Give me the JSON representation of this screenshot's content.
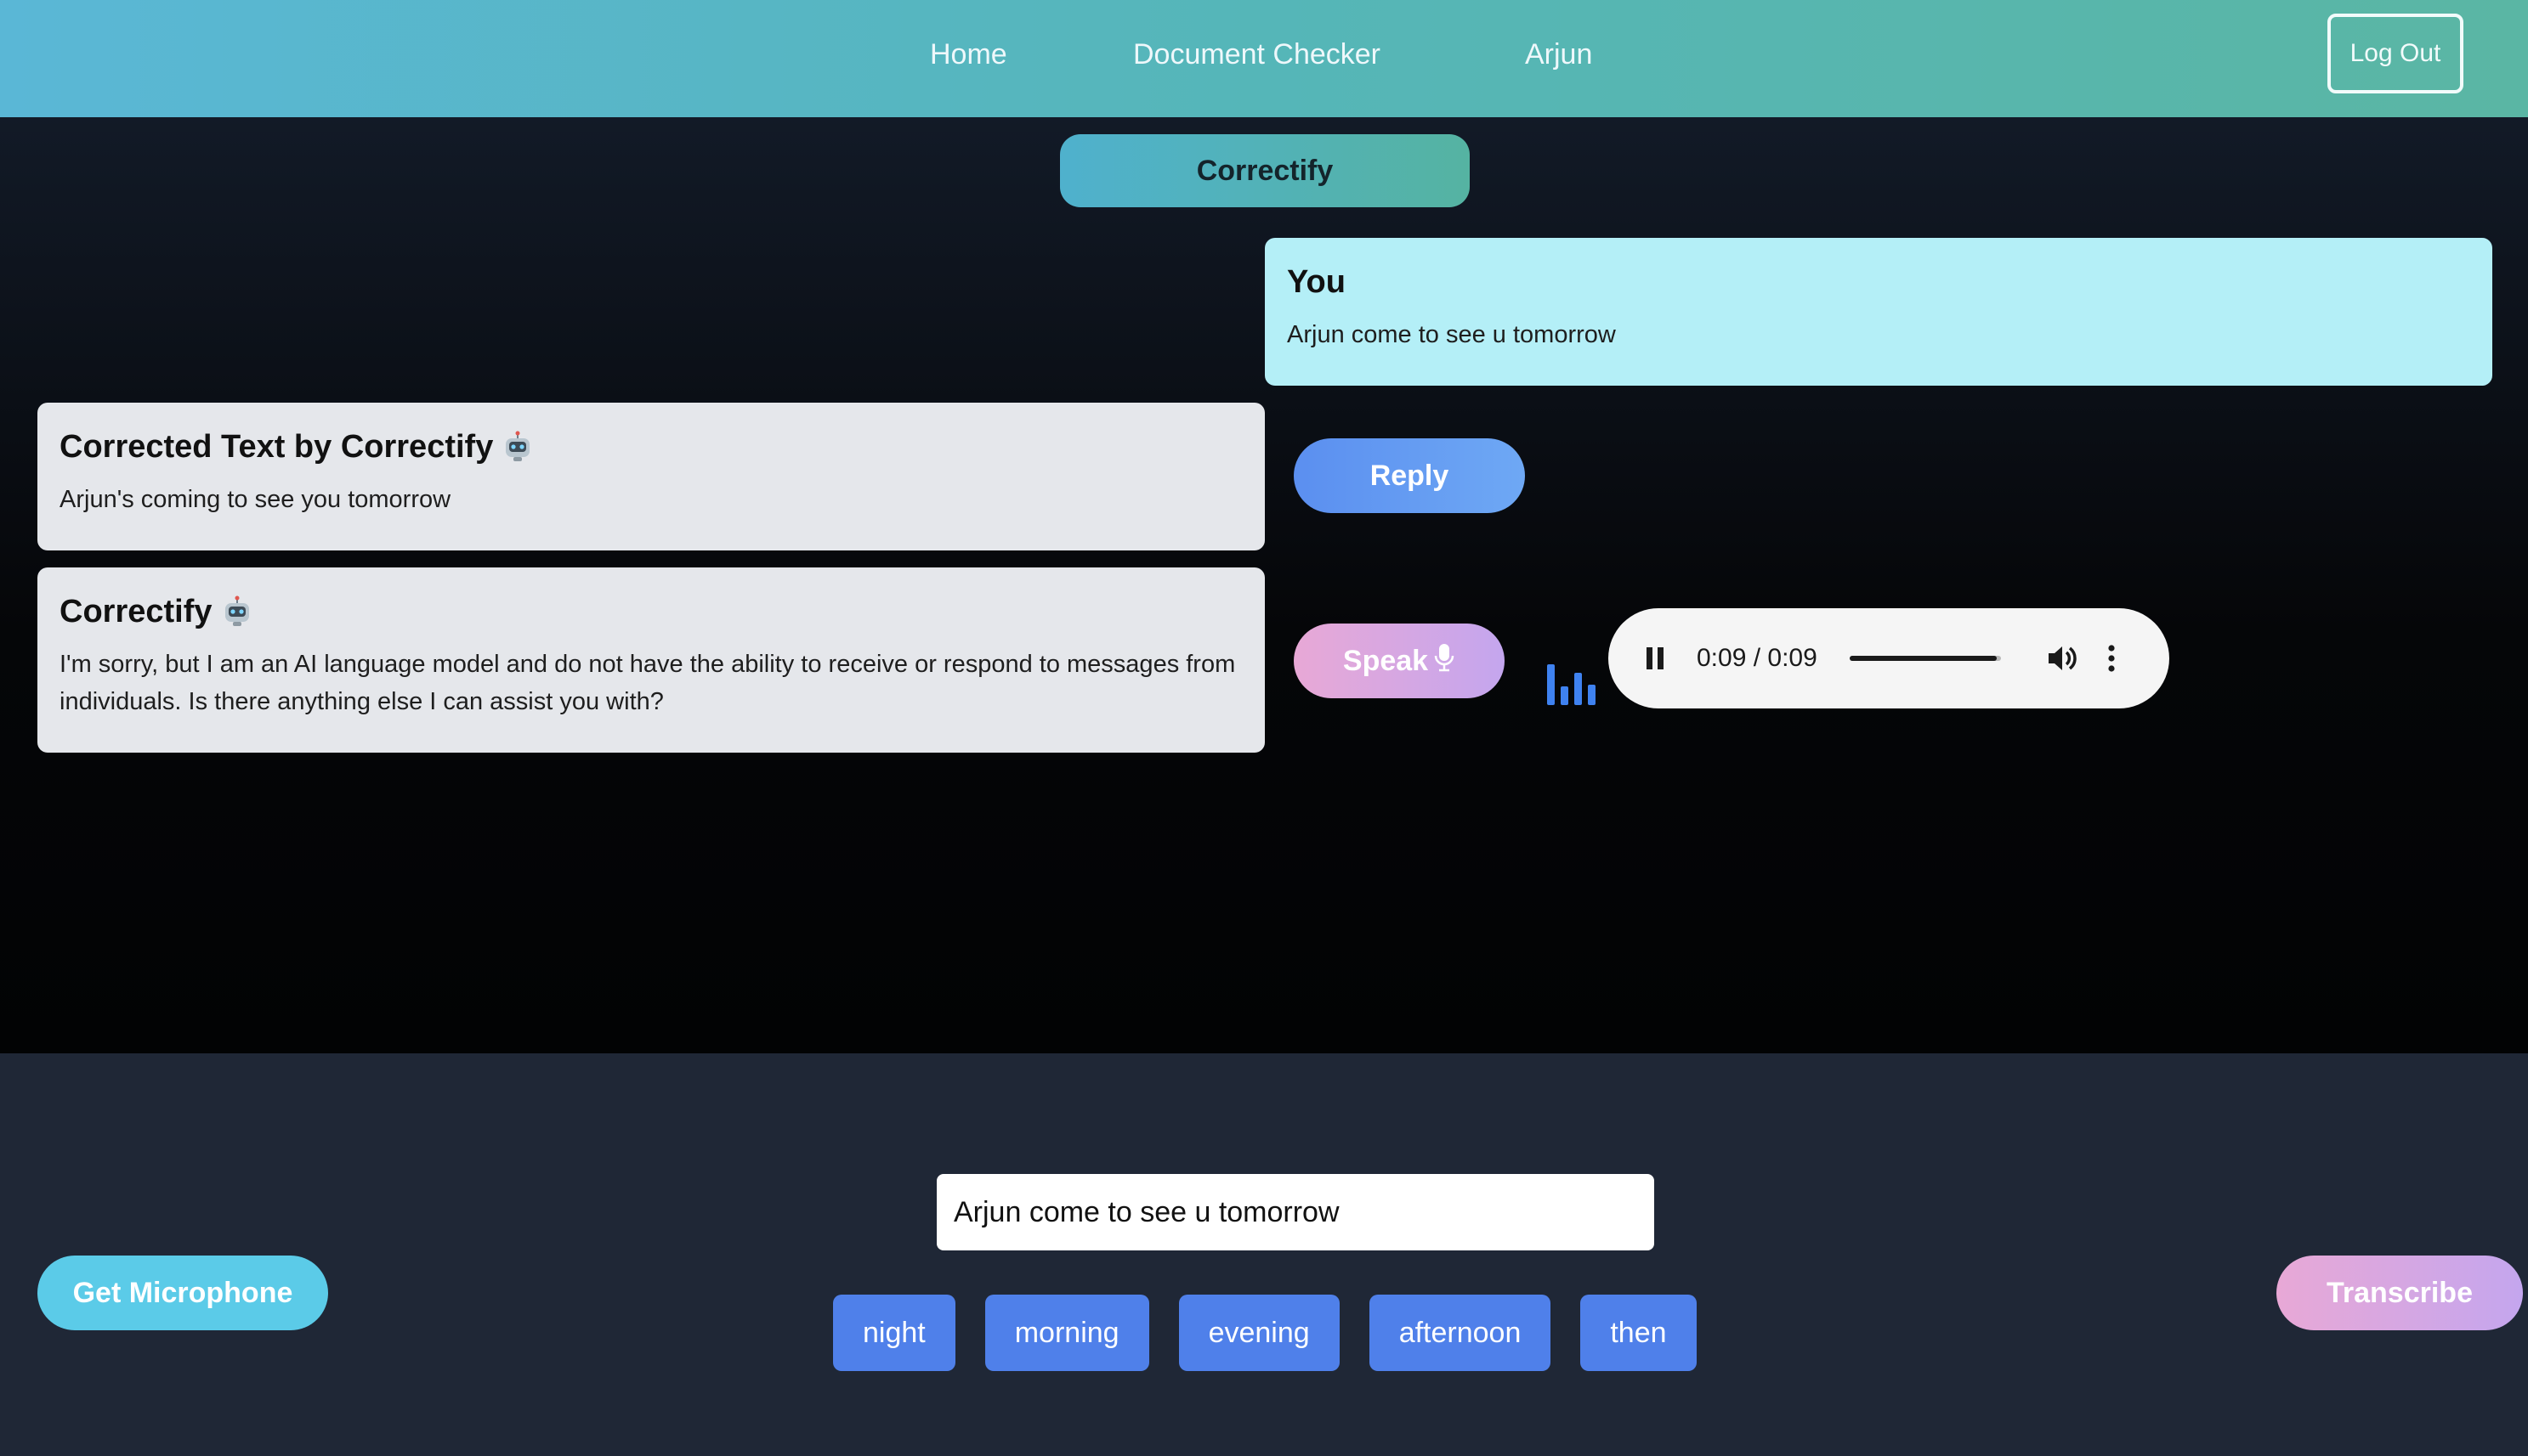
{
  "nav": {
    "links": [
      "Home",
      "Document Checker",
      "Arjun"
    ],
    "logout_label": "Log Out"
  },
  "brand": {
    "title": "Correctify"
  },
  "messages": {
    "user": {
      "title": "You",
      "body": "Arjun come to see u tomorrow"
    },
    "corrected": {
      "title": "Corrected Text by Correctify",
      "body": "Arjun's coming to see you tomorrow",
      "icon": "robot-icon"
    },
    "reply": {
      "title": "Correctify",
      "body": "I'm sorry, but I am an AI language model and do not have the ability to receive or respond to messages from individuals. Is there anything else I can assist you with?",
      "icon": "robot-icon"
    }
  },
  "actions": {
    "reply_label": "Reply",
    "speak_label": "Speak"
  },
  "audio": {
    "time": "0:09 / 0:09",
    "progress": 0.97,
    "state": "playing"
  },
  "bottom": {
    "input_value": "Arjun come to see u tomorrow",
    "microphone_label": "Get Microphone",
    "transcribe_label": "Transcribe",
    "suggestions": [
      "night",
      "morning",
      "evening",
      "afternoon",
      "then"
    ]
  },
  "colors": {
    "nav_gradient_start": "#5ab7d6",
    "nav_gradient_end": "#5ab6a4",
    "user_bubble": "#b4eff7",
    "bot_bubble": "#e5e7eb",
    "chip": "#4f80ea",
    "mic_button": "#5bcbe8"
  }
}
